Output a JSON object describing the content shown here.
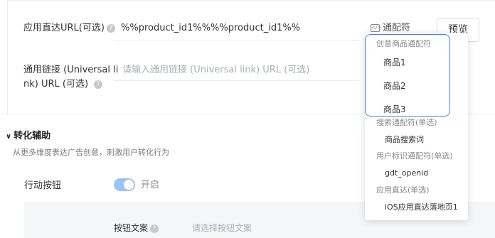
{
  "form": {
    "app_url_label": "应用直达URL(可选)",
    "app_url_value": "%%product_id1%%%%product_id1%%",
    "wildcard_label": "通配符",
    "preview_label": "预览",
    "universal_link_label_line1": "通用链接 (Universal li",
    "universal_link_label_line2": "nk) URL (可选)",
    "universal_link_placeholder": "请输入通用链接 (Universal link) URL (可选)"
  },
  "conversion": {
    "title": "转化辅助",
    "description": "从更多维度表达广告创意，刺激用户转化行为",
    "action_button_label": "行动按钮",
    "toggle_text": "开启",
    "toggle_on": true,
    "button_copy_label": "按钮文案",
    "button_copy_placeholder": "请选择按钮文案"
  },
  "dropdown": {
    "groups": [
      {
        "title": "创意商品通配符",
        "items": [
          "商品1",
          "商品2",
          "商品3"
        ]
      },
      {
        "title": "搜索通配符(单选)",
        "items": [
          "商品搜索词"
        ]
      },
      {
        "title": "用户标识通配符(单选)",
        "items": [
          "gdt_openid"
        ]
      },
      {
        "title": "应用直达(单选)",
        "items": [
          "iOS应用直达落地页1"
        ]
      }
    ]
  },
  "colors": {
    "accent": "#3b82f6",
    "toggle_bg": "#9dc2f7",
    "placeholder": "#aab0b8"
  }
}
